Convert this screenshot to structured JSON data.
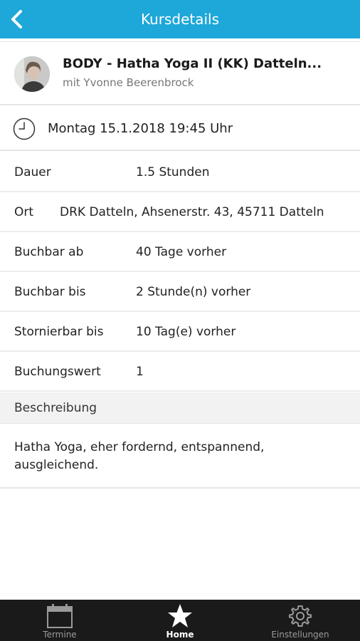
{
  "header": {
    "title": "Kursdetails",
    "back_icon": "chevron-left-icon",
    "background": "#1ea7d9"
  },
  "course": {
    "title": "BODY - Hatha Yoga II (KK) Datteln...",
    "instructor": "mit Yvonne Beerenbrock"
  },
  "datetime": {
    "icon": "clock-icon",
    "text": "Montag 15.1.2018 19:45 Uhr"
  },
  "details": [
    {
      "label": "Dauer",
      "value": "1.5 Stunden"
    },
    {
      "label": "Ort",
      "value": "DRK Datteln, Ahsenerstr. 43, 45711 Datteln"
    },
    {
      "label": "Buchbar ab",
      "value": "40 Tage vorher"
    },
    {
      "label": "Buchbar bis",
      "value": "2 Stunde(n) vorher"
    },
    {
      "label": "Stornierbar bis",
      "value": "10 Tag(e) vorher"
    },
    {
      "label": "Buchungswert",
      "value": "1"
    }
  ],
  "description": {
    "header": "Beschreibung",
    "text": "Hatha Yoga, eher fordernd, entspannend, ausgleichend."
  },
  "tabbar": {
    "tabs": [
      {
        "label": "Termine",
        "icon": "calendar-icon",
        "active": false
      },
      {
        "label": "Home",
        "icon": "star-icon",
        "active": true
      },
      {
        "label": "Einstellungen",
        "icon": "gear-icon",
        "active": false
      }
    ]
  }
}
